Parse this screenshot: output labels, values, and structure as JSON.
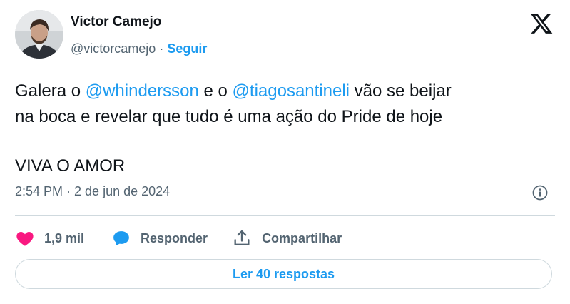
{
  "author": {
    "name": "Victor Camejo",
    "handle": "@victorcamejo",
    "separator": "·",
    "follow_label": "Seguir"
  },
  "tweet": {
    "line1": [
      {
        "text": "Galera o ",
        "mention": false
      },
      {
        "text": "@whindersson",
        "mention": true
      },
      {
        "text": " e o ",
        "mention": false
      },
      {
        "text": "@tiagosantineli",
        "mention": true
      },
      {
        "text": " vão se beijar",
        "mention": false
      }
    ],
    "line2": "na boca e revelar que tudo é uma ação do Pride de hoje",
    "line3": "VIVA O AMOR"
  },
  "timestamp": "2:54 PM · 2 de jun de 2024",
  "actions": {
    "like_count": "1,9 mil",
    "reply_label": "Responder",
    "share_label": "Compartilhar"
  },
  "read_replies_label": "Ler 40 respostas",
  "colors": {
    "accent": "#1d9bf0",
    "like": "#f91880",
    "text": "#0f1419",
    "muted": "#536471",
    "border": "#cfd9de"
  },
  "icons": [
    "x-logo-icon",
    "info-icon",
    "heart-icon",
    "reply-bubble-icon",
    "share-icon"
  ]
}
